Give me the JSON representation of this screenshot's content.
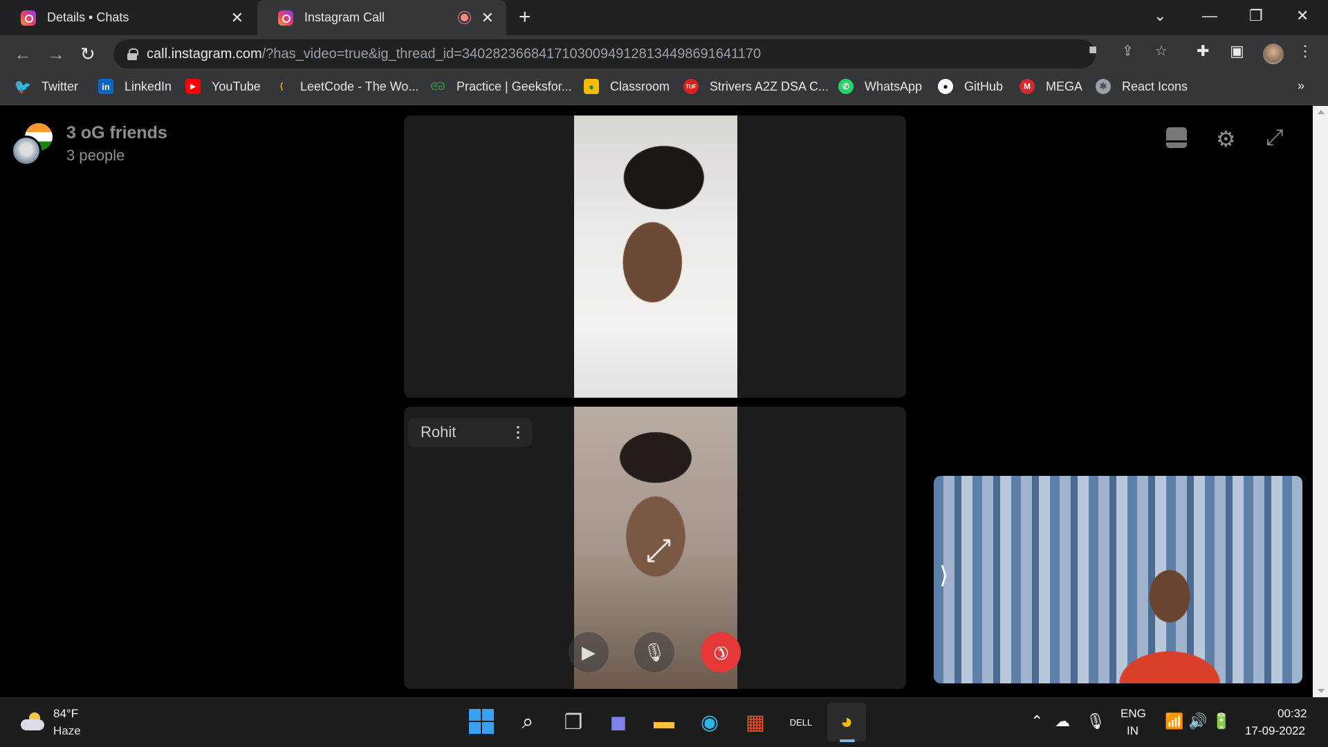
{
  "browser": {
    "tabs": [
      {
        "title": "Details • Chats"
      },
      {
        "title": "Instagram Call"
      }
    ],
    "url_host": "call.instagram.com",
    "url_path": "/?has_video=true&ig_thread_id=340282366841710300949128134498691641170",
    "bookmarks": [
      {
        "label": "Twitter",
        "icon": "twitter-icon",
        "color": "#1d9bf0"
      },
      {
        "label": "LinkedIn",
        "icon": "linkedin-icon",
        "color": "#0a66c2"
      },
      {
        "label": "YouTube",
        "icon": "youtube-icon",
        "color": "#ff0000"
      },
      {
        "label": "LeetCode - The Wo...",
        "icon": "leetcode-icon",
        "color": "#ffa116"
      },
      {
        "label": "Practice | Geeksfor...",
        "icon": "geeksforgeeks-icon",
        "color": "#2f8d46"
      },
      {
        "label": "Classroom",
        "icon": "classroom-icon",
        "color": "#f9bc05"
      },
      {
        "label": "Strivers A2Z DSA C...",
        "icon": "tuf-icon",
        "color": "#e02020"
      },
      {
        "label": "WhatsApp",
        "icon": "whatsapp-icon",
        "color": "#25d366"
      },
      {
        "label": "GitHub",
        "icon": "github-icon",
        "color": "#ffffff"
      },
      {
        "label": "MEGA",
        "icon": "mega-icon",
        "color": "#d9272e"
      },
      {
        "label": "React Icons",
        "icon": "react-icons-icon",
        "color": "#9aa0a6"
      }
    ],
    "more_bookmarks": "»"
  },
  "call": {
    "group_name": "3 oG friends",
    "group_count": "3 people",
    "participant_label": "Rohit",
    "participant_menu": "⋮",
    "accent_end": "#e63838"
  },
  "taskbar": {
    "weather_temp": "84°F",
    "weather_desc": "Haze",
    "lang_top": "ENG",
    "lang_bottom": "IN",
    "time": "00:32",
    "date": "17-09-2022"
  }
}
